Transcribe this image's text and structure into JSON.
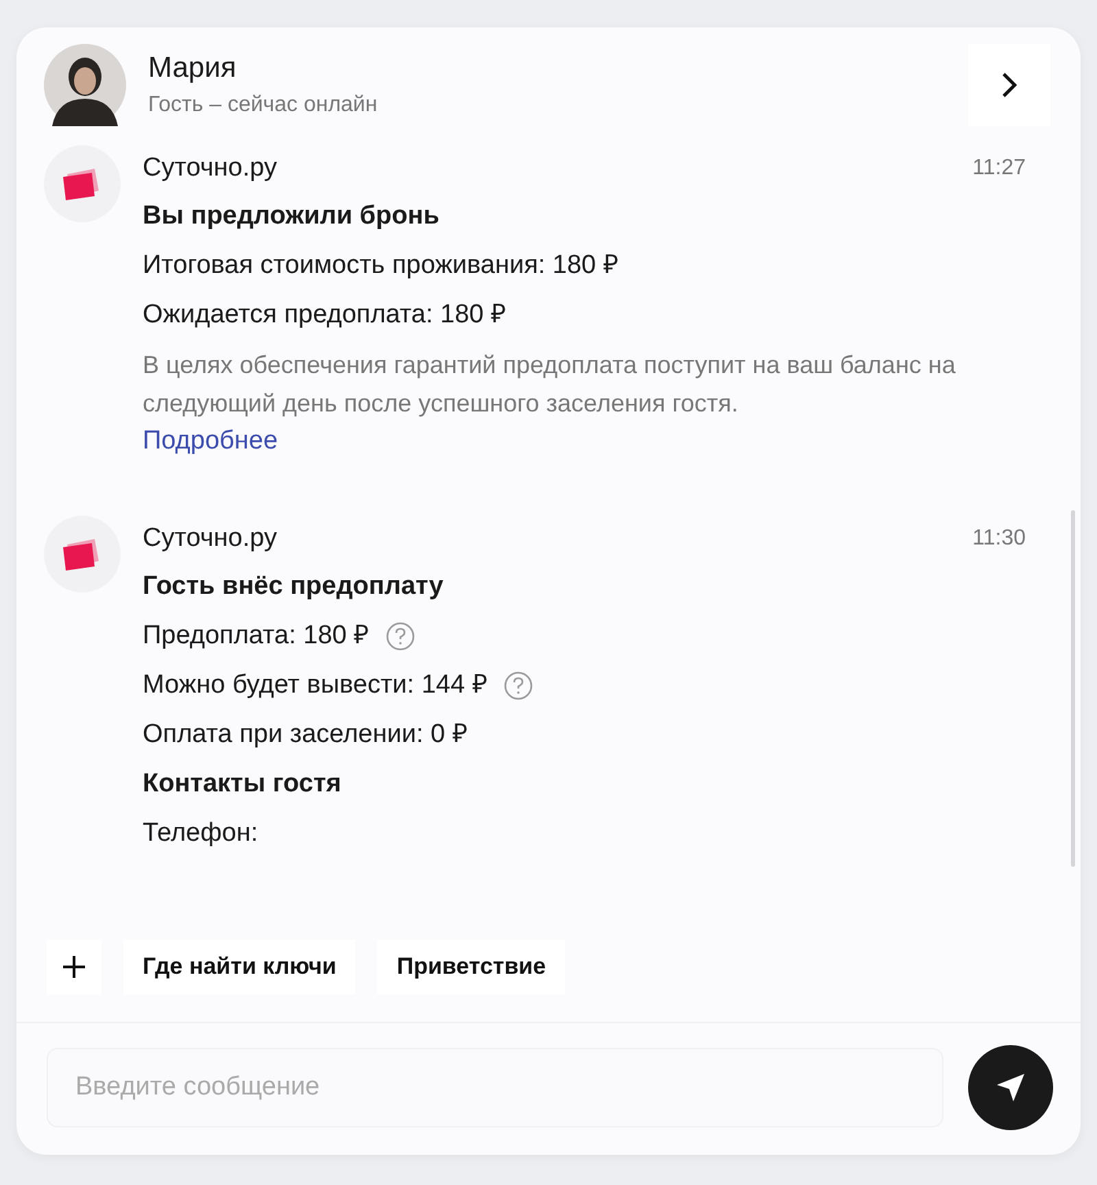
{
  "header": {
    "name": "Мария",
    "status": "Гость – сейчас онлайн"
  },
  "messages": [
    {
      "sender": "Суточно.ру",
      "time": "11:27",
      "lines": [
        {
          "kind": "title",
          "text": "Вы предложили бронь"
        },
        {
          "kind": "text",
          "text": "Итоговая стоимость проживания: 180 ₽"
        },
        {
          "kind": "text",
          "text": "Ожидается предоплата: 180 ₽"
        },
        {
          "kind": "note",
          "text": "В целях обеспечения гарантий предоплата поступит на ваш баланс на следующий день после успешного заселения гостя."
        },
        {
          "kind": "link",
          "text": "Подробнее"
        }
      ]
    },
    {
      "sender": "Суточно.ру",
      "time": "11:30",
      "lines": [
        {
          "kind": "title",
          "text": "Гость внёс предоплату"
        },
        {
          "kind": "help",
          "text": "Предоплата: 180 ₽"
        },
        {
          "kind": "help",
          "text": "Можно будет вывести: 144 ₽"
        },
        {
          "kind": "text",
          "text": "Оплата при заселении: 0 ₽"
        },
        {
          "kind": "title",
          "text": "Контакты гостя"
        },
        {
          "kind": "text",
          "text": "Телефон:"
        }
      ]
    }
  ],
  "quick_replies": [
    "Где найти ключи",
    "Приветствие"
  ],
  "composer": {
    "placeholder": "Введите сообщение"
  }
}
